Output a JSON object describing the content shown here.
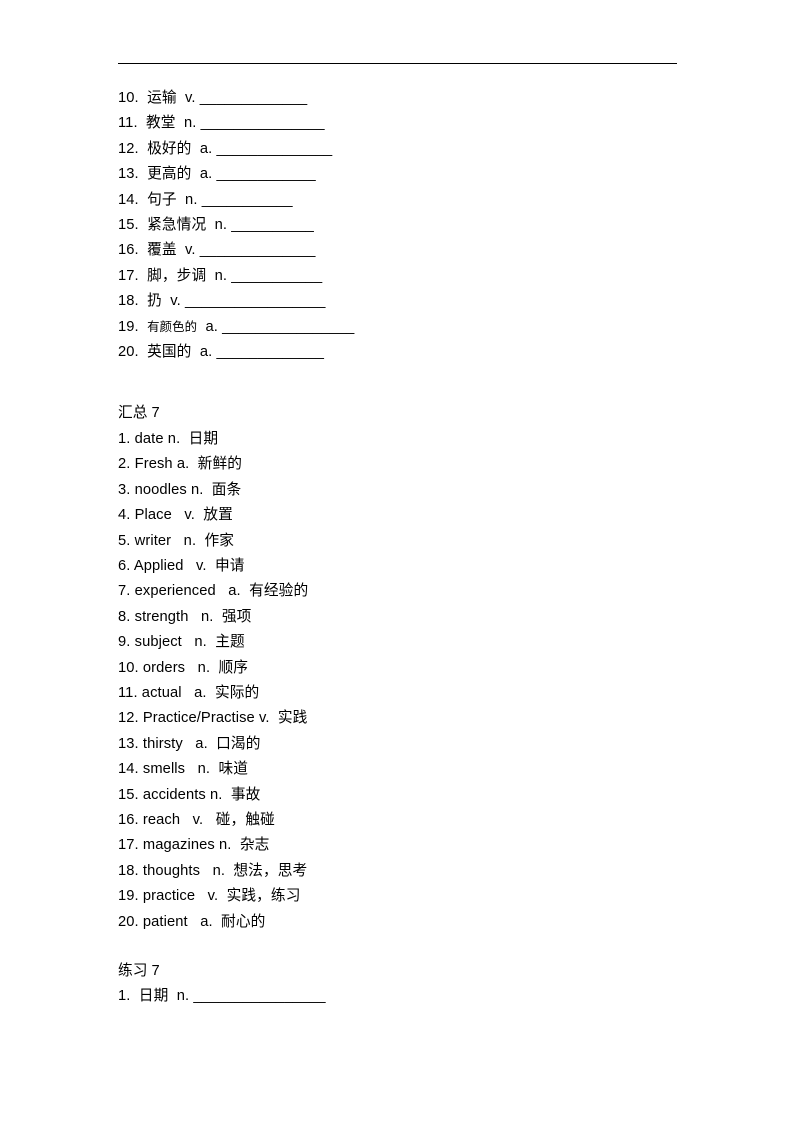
{
  "document": {
    "title": "Vocabulary Worksheet",
    "background_color": "#ffffff",
    "text_color": "#000000",
    "rule_color": "#000000"
  },
  "exercise_block_top": {
    "name": "practice-list-continued",
    "items": [
      {
        "num": "10.",
        "cn": "运输",
        "pos": "v.",
        "blank": "_____________"
      },
      {
        "num": "11.",
        "cn": "教堂",
        "pos": "n.",
        "blank": "_______________"
      },
      {
        "num": "12.",
        "cn": "极好的",
        "pos": "a.",
        "blank": "______________"
      },
      {
        "num": "13.",
        "cn": "更高的",
        "pos": "a.",
        "blank": "____________"
      },
      {
        "num": "14.",
        "cn": "句子",
        "pos": "n.",
        "blank": "___________"
      },
      {
        "num": "15.",
        "cn": "紧急情况",
        "pos": "n.",
        "blank": "__________"
      },
      {
        "num": "16.",
        "cn": "覆盖",
        "pos": "v.",
        "blank": "______________"
      },
      {
        "num": "17.",
        "cn": "脚，步调",
        "pos": "n.",
        "blank": "___________"
      },
      {
        "num": "18.",
        "cn": "扔",
        "pos": "v.",
        "blank": "_________________"
      },
      {
        "num": "19.",
        "cn": "有颜色的",
        "pos": "a.",
        "blank": "________________",
        "cn_small": true
      },
      {
        "num": "20.",
        "cn": "英国的",
        "pos": "a.",
        "blank": "_____________"
      }
    ]
  },
  "summary_section": {
    "heading": "汇总 7",
    "items": [
      {
        "num": "1.",
        "en": "date",
        "pos": "n.",
        "cn": "日期"
      },
      {
        "num": "2.",
        "en": "Fresh",
        "pos": "a.",
        "cn": "新鲜的"
      },
      {
        "num": "3.",
        "en": "noodles",
        "pos": "n.",
        "cn": "面条"
      },
      {
        "num": "4.",
        "en": "Place",
        "pos": "v.",
        "cn": "放置"
      },
      {
        "num": "5.",
        "en": "writer",
        "pos": "n.",
        "cn": "作家"
      },
      {
        "num": "6.",
        "en": "Applied",
        "pos": "v.",
        "cn": "申请"
      },
      {
        "num": "7.",
        "en": "experienced",
        "pos": "a.",
        "cn": "有经验的"
      },
      {
        "num": "8.",
        "en": "strength",
        "pos": "n.",
        "cn": "强项"
      },
      {
        "num": "9.",
        "en": "subject",
        "pos": "n.",
        "cn": "主题"
      },
      {
        "num": "10.",
        "en": "orders",
        "pos": "n.",
        "cn": "顺序"
      },
      {
        "num": "11.",
        "en": "actual",
        "pos": "a.",
        "cn": "实际的"
      },
      {
        "num": "12.",
        "en": "Practice/Practise",
        "pos": "v.",
        "cn": "实践"
      },
      {
        "num": "13.",
        "en": "thirsty",
        "pos": "a.",
        "cn": "口渴的"
      },
      {
        "num": "14.",
        "en": "smells",
        "pos": "n.",
        "cn": "味道"
      },
      {
        "num": "15.",
        "en": "accidents",
        "pos": "n.",
        "cn": "事故"
      },
      {
        "num": "16.",
        "en": "reach",
        "pos": "v.",
        "cn": "碰，触碰"
      },
      {
        "num": "17.",
        "en": "magazines",
        "pos": "n.",
        "cn": "杂志"
      },
      {
        "num": "18.",
        "en": "thoughts",
        "pos": "n.",
        "cn": "想法，思考"
      },
      {
        "num": "19.",
        "en": "practice",
        "pos": "v.",
        "cn": "实践，练习"
      },
      {
        "num": "20.",
        "en": "patient",
        "pos": "a.",
        "cn": "耐心的"
      }
    ],
    "lines": [
      "1. date n.  日期",
      "2. Fresh a.  新鲜的",
      "3. noodles n.  面条",
      "4. Place   v.  放置",
      "5. writer   n.  作家",
      "6. Applied   v.  申请",
      "7. experienced   a.  有经验的",
      "8. strength   n.  强项",
      "9. subject   n.  主题",
      "10. orders   n.  顺序",
      "11. actual   a.  实际的",
      "12. Practice/Practise v.  实践",
      "13. thirsty   a.  口渴的",
      "14. smells   n.  味道",
      "15. accidents n.  事故",
      "16. reach   v.   碰，触碰",
      "17. magazines n.  杂志",
      "18. thoughts   n.  想法，思考",
      "19. practice   v.  实践，练习",
      "20. patient   a.  耐心的"
    ]
  },
  "practice_section": {
    "heading": "练习 7",
    "lines": [
      "1.  日期  n. ________________"
    ],
    "items": [
      {
        "num": "1.",
        "cn": "日期",
        "pos": "n.",
        "blank": "________________"
      }
    ]
  },
  "top_block_lines": [
    "10.  运输  v. _____________",
    "11.  教堂  n. _______________",
    "12.  极好的  a. ______________",
    "13.  更高的  a. ____________",
    "14.  句子  n. ___________",
    "15.  紧急情况  n. __________",
    "16.  覆盖  v. ______________",
    "17.  脚，步调  n. ___________",
    "18.  扔  v. _________________",
    "19.  有颜色的  a. ________________",
    "20.  英国的  a. _____________"
  ]
}
